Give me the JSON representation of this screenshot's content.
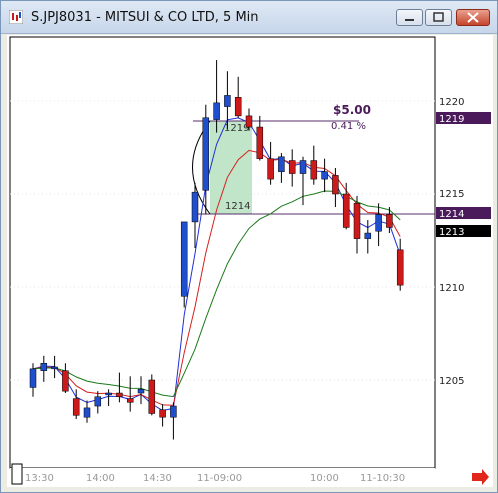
{
  "window": {
    "title": "S.JPJ8031 - MITSUI & CO LTD, 5 Min",
    "buttons": [
      "minimize",
      "restore",
      "close"
    ]
  },
  "chart": {
    "price_axis_labels": [
      "1220",
      "1215",
      "1210",
      "1205"
    ],
    "time_axis_labels": [
      "13:30",
      "14:00",
      "14:30",
      "11-09:00",
      "10:00",
      "11-10:30"
    ],
    "price_tags": [
      {
        "value": "1219",
        "style": "purple"
      },
      {
        "value": "1214",
        "style": "purple"
      },
      {
        "value": "1213",
        "style": "black"
      }
    ],
    "measure": {
      "amount": "$5.00",
      "percent": "0.41 %",
      "top_label": "1219",
      "bottom_label": "1214"
    }
  },
  "chart_data": {
    "type": "candlestick",
    "ylim": [
      1202.5,
      1222.5
    ],
    "candles_ohlc": [
      [
        1204.6,
        1205.9,
        1204.1,
        1205.6
      ],
      [
        1205.5,
        1206.3,
        1204.9,
        1205.9
      ],
      [
        1205.6,
        1206.3,
        1205.1,
        1205.7
      ],
      [
        1205.5,
        1205.9,
        1204.3,
        1204.4
      ],
      [
        1204.0,
        1204.5,
        1202.9,
        1203.1
      ],
      [
        1203.0,
        1203.9,
        1202.7,
        1203.5
      ],
      [
        1203.6,
        1204.4,
        1203.2,
        1204.1
      ],
      [
        1204.2,
        1204.5,
        1203.6,
        1204.3
      ],
      [
        1204.3,
        1205.4,
        1203.8,
        1204.1
      ],
      [
        1204.0,
        1205.2,
        1203.3,
        1203.8
      ],
      [
        1204.3,
        1205.2,
        1203.7,
        1204.5
      ],
      [
        1205.0,
        1205.3,
        1203.1,
        1203.2
      ],
      [
        1203.4,
        1203.7,
        1202.5,
        1203.0
      ],
      [
        1203.0,
        1203.8,
        1201.8,
        1203.6
      ],
      [
        1209.5,
        1213.2,
        1208.9,
        1213.5
      ],
      [
        1213.5,
        1215.6,
        1212.1,
        1215.1
      ],
      [
        1215.2,
        1219.8,
        1213.9,
        1219.1
      ],
      [
        1219.0,
        1222.2,
        1218.3,
        1219.9
      ],
      [
        1219.7,
        1221.6,
        1218.5,
        1220.3
      ],
      [
        1220.2,
        1221.3,
        1219.1,
        1219.2
      ],
      [
        1219.2,
        1219.6,
        1218.4,
        1218.6
      ],
      [
        1218.6,
        1219.2,
        1216.8,
        1216.9
      ],
      [
        1216.9,
        1217.8,
        1215.5,
        1215.8
      ],
      [
        1216.2,
        1217.2,
        1215.6,
        1217.0
      ],
      [
        1216.8,
        1217.4,
        1215.4,
        1216.1
      ],
      [
        1216.1,
        1217.0,
        1214.4,
        1216.8
      ],
      [
        1216.8,
        1217.6,
        1215.5,
        1215.8
      ],
      [
        1215.8,
        1216.9,
        1215.1,
        1216.2
      ],
      [
        1216.0,
        1216.4,
        1214.3,
        1215.0
      ],
      [
        1215.0,
        1215.6,
        1213.1,
        1213.2
      ],
      [
        1214.5,
        1214.9,
        1211.8,
        1212.6
      ],
      [
        1212.6,
        1213.6,
        1211.8,
        1212.9
      ],
      [
        1213.0,
        1214.5,
        1212.2,
        1213.9
      ],
      [
        1213.9,
        1214.3,
        1212.9,
        1213.2
      ],
      [
        1212.0,
        1212.6,
        1209.8,
        1210.1
      ]
    ]
  }
}
